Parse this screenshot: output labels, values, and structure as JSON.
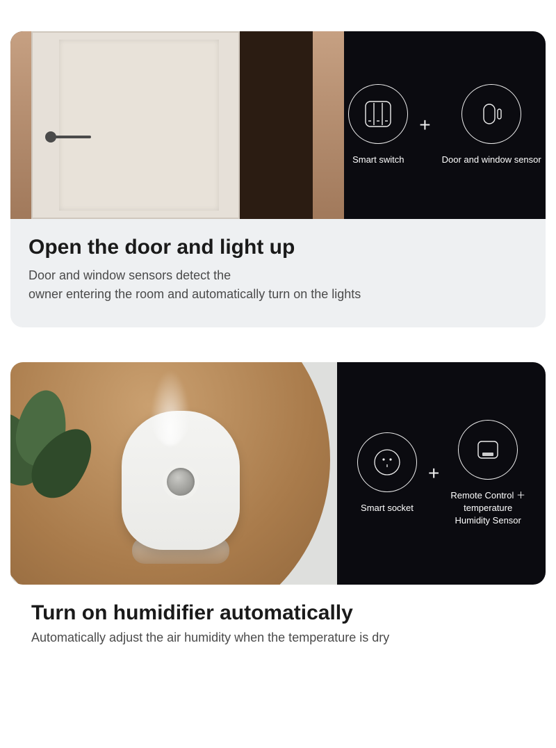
{
  "card1": {
    "iconA": {
      "label": "Smart switch",
      "name": "smart-switch-icon"
    },
    "iconB": {
      "label": "Door and window sensor",
      "name": "door-window-sensor-icon"
    },
    "title": "Open the door and light up",
    "desc": "Door and window sensors detect the\nowner entering the room and automatically turn on the lights"
  },
  "card2": {
    "iconA": {
      "label": "Smart socket",
      "name": "smart-socket-icon"
    },
    "iconB": {
      "label": "Remote Control ＋\ntemperature\nHumidity Sensor",
      "name": "remote-temp-humidity-sensor-icon"
    },
    "title": "Turn on humidifier automatically",
    "desc": "Automatically adjust the air humidity when the temperature is dry"
  }
}
